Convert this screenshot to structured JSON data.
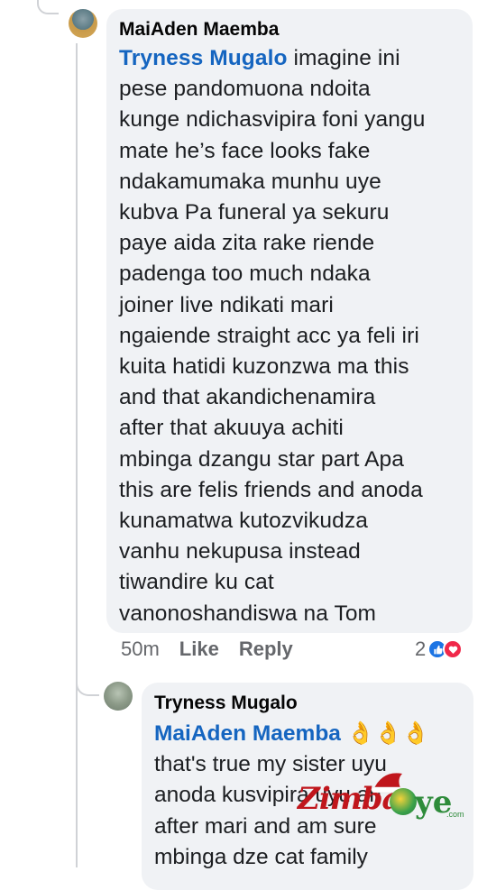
{
  "comment": {
    "author": "MaiAden Maemba",
    "mention": "Tryness Mugalo",
    "text_first": "  imagine ini",
    "text_rest": "pese pandomuona ndoita\nkunge ndichasvipira foni yangu\nmate he’s face looks fake\nndakamumaka munhu uye\nkubva Pa funeral ya sekuru\npaye aida zita rake riende\npadenga too much ndaka\njoiner live ndikati mari\nngaiende straight acc ya feli iri\nkuita hatidi kuzonzwa ma this\nand that akandichenamira\nafter that akuuya achiti\nmbinga dzangu star part Apa\nthis are felis friends and anoda\nkunamatwa kutozvikudza\nvanhu nekupusa instead\ntiwandire ku cat\nvanonoshandiswa na Tom",
    "time": "50m",
    "like_label": "Like",
    "reply_label": "Reply",
    "reaction_count": "2",
    "reaction_icons": [
      "like-icon",
      "love-icon"
    ]
  },
  "reply": {
    "author": "Tryness Mugalo",
    "mention": "MaiAden Maemba",
    "emojis": "👌👌👌",
    "text": "that's true my sister uyu\nanoda kusvipira uyu ari\nafter mari and am sure\nmbinga dze cat family"
  },
  "watermark": {
    "brand": "Zimba",
    "suffix": "ye",
    "domain": ".com"
  },
  "colors": {
    "mention": "#1565c0",
    "bubble": "#f0f2f5",
    "meta": "#65676b",
    "like": "#1b74e4",
    "love": "#f0284a"
  }
}
